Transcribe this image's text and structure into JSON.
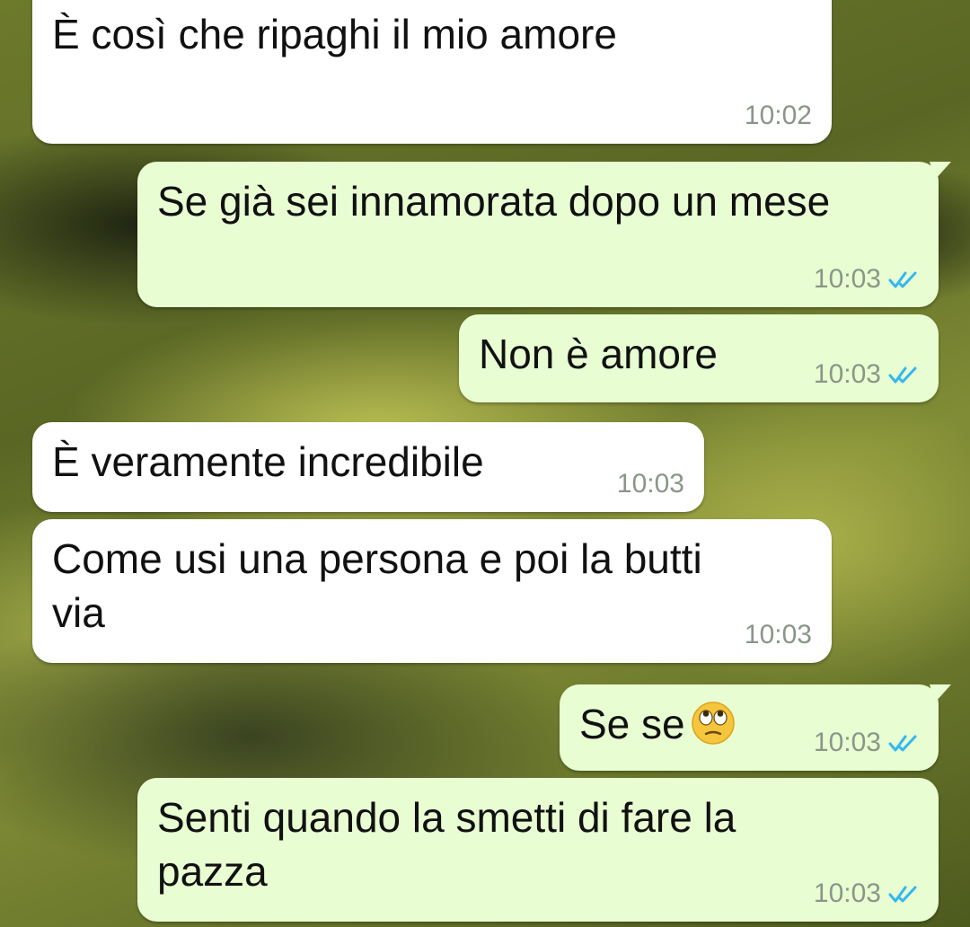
{
  "messages": [
    {
      "direction": "incoming",
      "text": "È così che ripaghi il mio amore",
      "time": "10:02"
    },
    {
      "direction": "outgoing",
      "text": "Se già sei innamorata dopo un mese",
      "time": "10:03",
      "status": "read-double-check-icon"
    },
    {
      "direction": "outgoing",
      "text": "Non è amore",
      "time": "10:03",
      "status": "read-double-check-icon"
    },
    {
      "direction": "incoming",
      "text": "È veramente incredibile",
      "time": "10:03"
    },
    {
      "direction": "incoming",
      "text": "Come usi una persona e poi la butti via",
      "time": "10:03"
    },
    {
      "direction": "outgoing",
      "text": "Se se",
      "emoji": "face-with-rolling-eyes-emoji",
      "time": "10:03",
      "status": "read-double-check-icon"
    },
    {
      "direction": "outgoing",
      "text": "Senti quando la smetti di fare la pazza",
      "time": "10:03",
      "status": "read-double-check-icon"
    }
  ],
  "colors": {
    "incoming_bubble": "#ffffff",
    "outgoing_bubble": "#e8fed2",
    "read_ticks": "#34b7f1",
    "timestamp": "#8a9688"
  }
}
